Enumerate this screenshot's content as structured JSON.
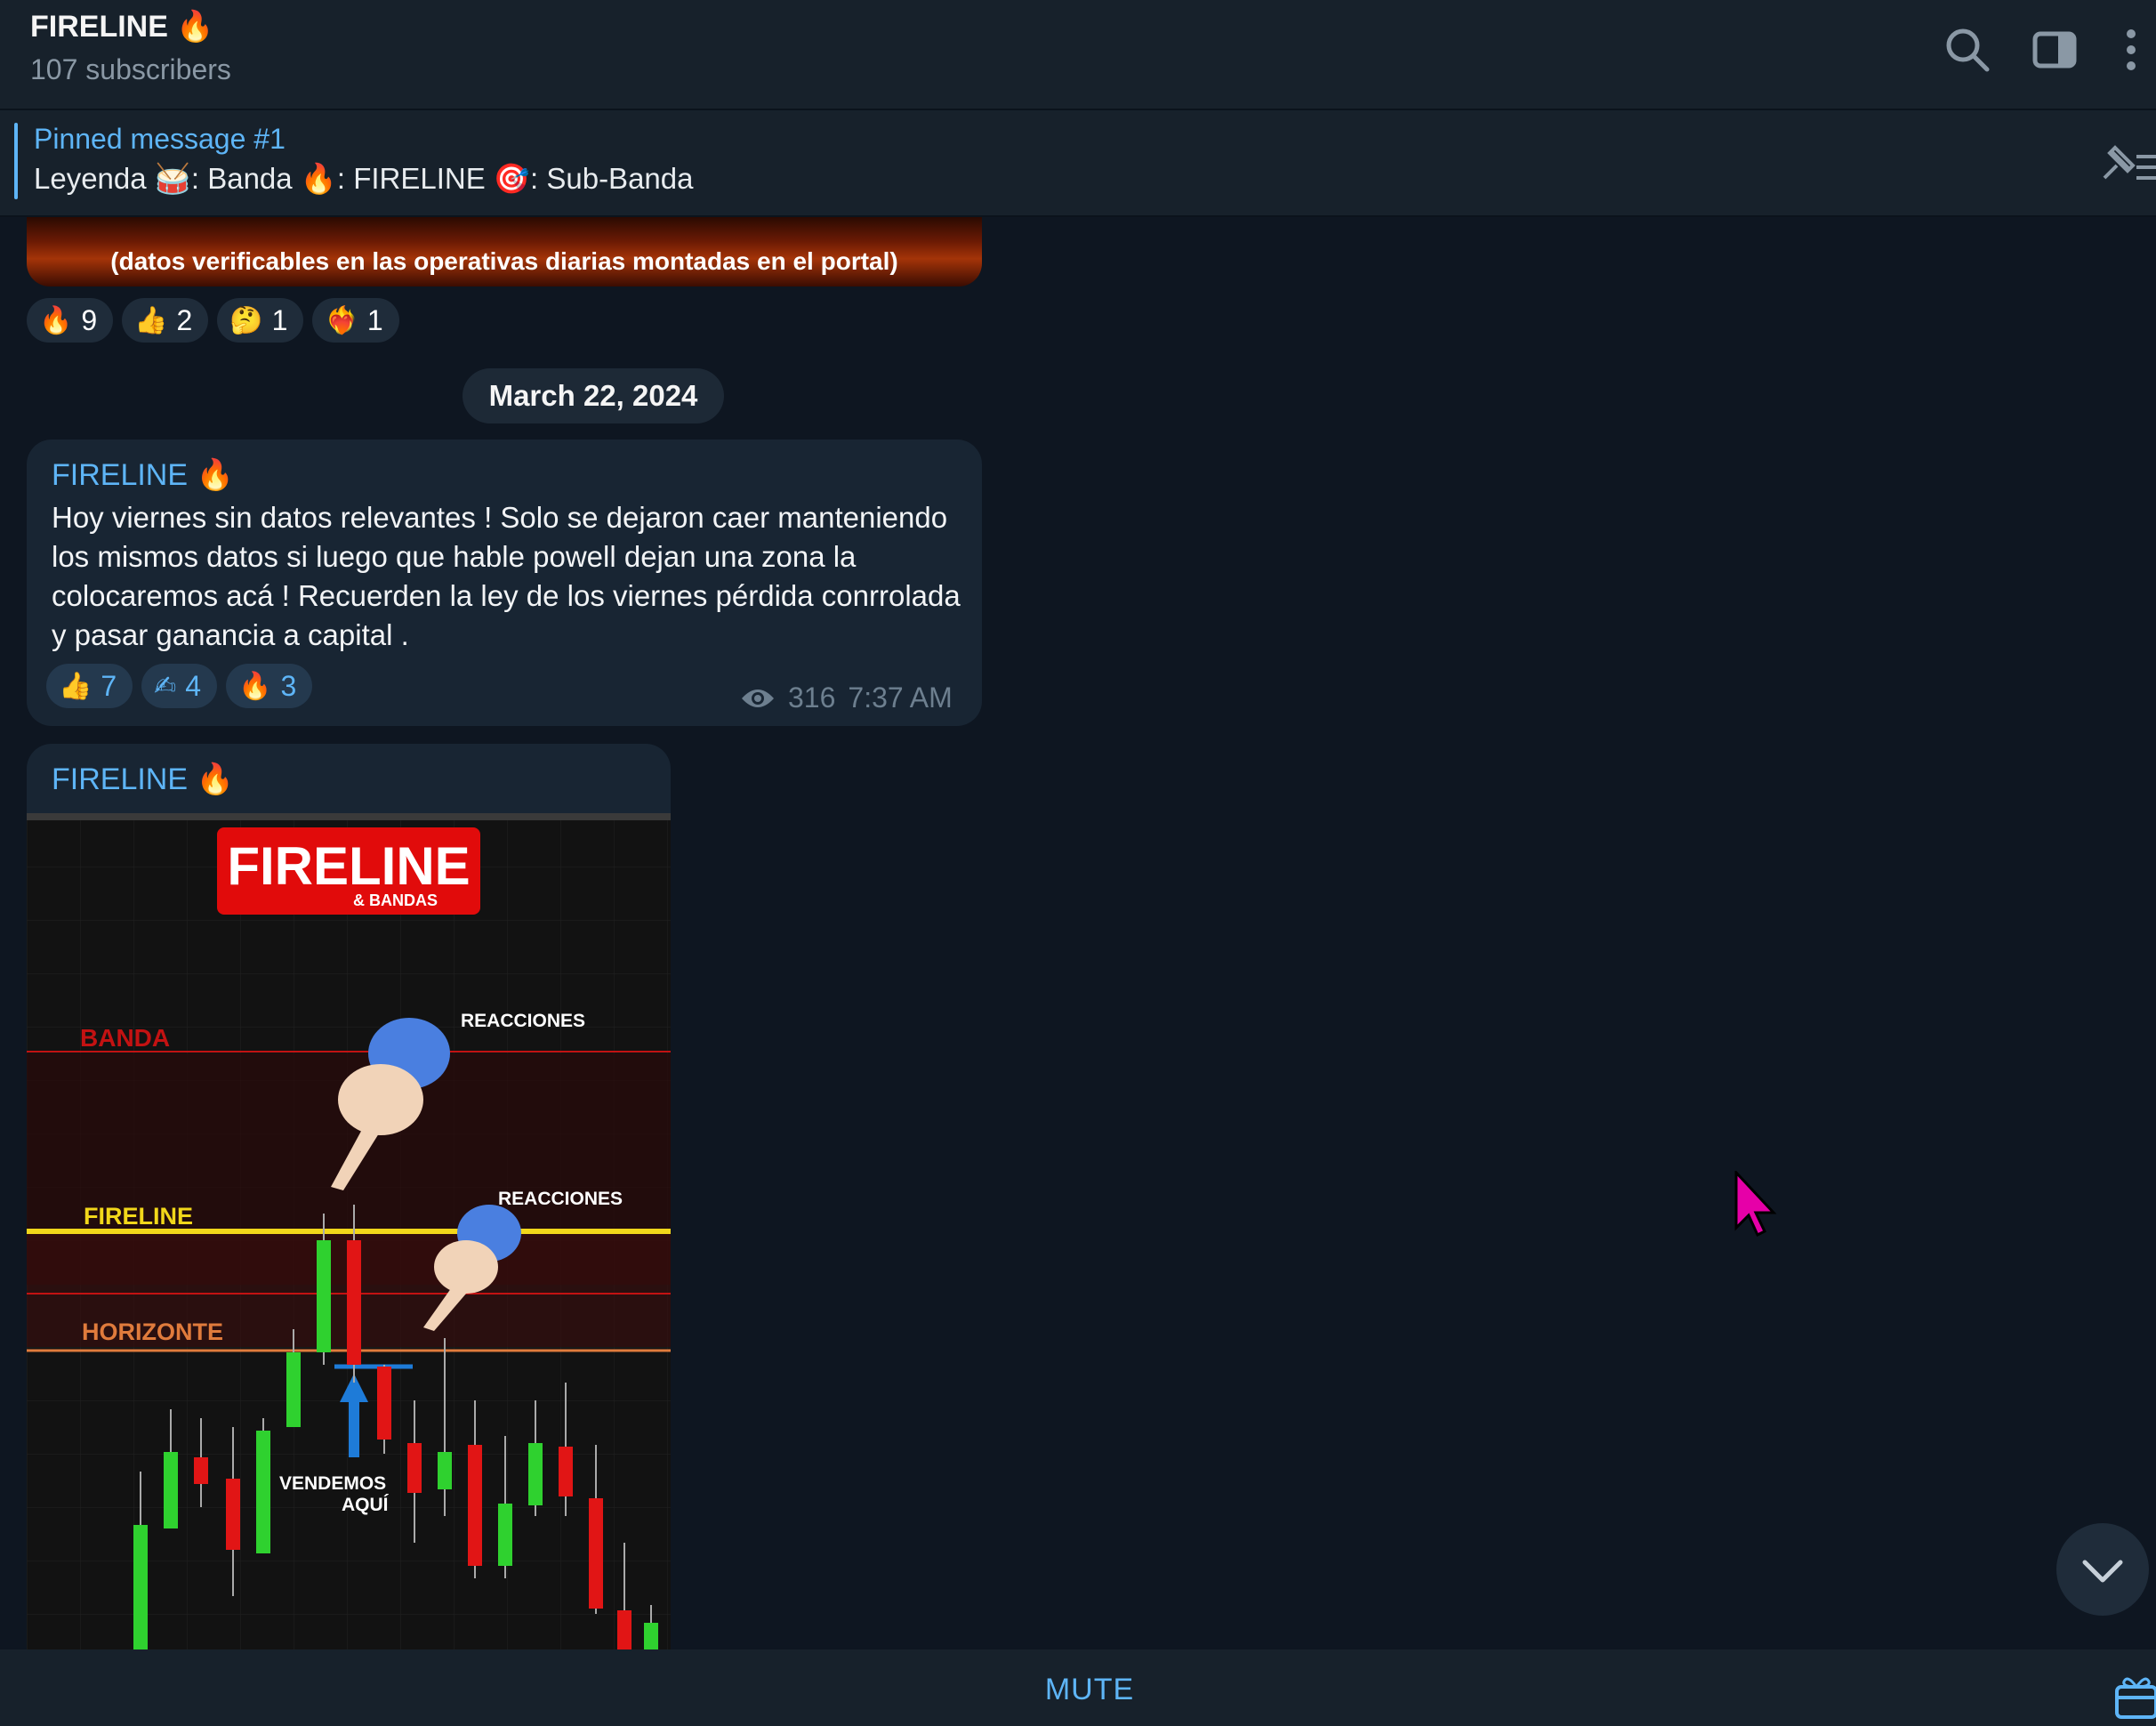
{
  "header": {
    "title": "FIRELINE",
    "title_emoji": "🔥",
    "subscribers": "107 subscribers",
    "icons": [
      "search-icon",
      "sidebar-toggle-icon",
      "more-vertical-icon"
    ]
  },
  "pinned": {
    "title": "Pinned message #1",
    "text": "Leyenda 🥁: Banda  🔥: FIRELINE  🎯: Sub-Banda"
  },
  "previous_post": {
    "image_caption": "(datos verificables en las operativas diarias montadas en el portal)",
    "reactions": [
      {
        "emoji": "🔥",
        "count": "9"
      },
      {
        "emoji": "👍",
        "count": "2"
      },
      {
        "emoji": "🤔",
        "count": "1"
      },
      {
        "emoji": "❤‍🔥",
        "count": "1"
      }
    ]
  },
  "date_separator": "March 22, 2024",
  "message1": {
    "author": "FIRELINE",
    "author_emoji": "🔥",
    "text": "Hoy viernes sin datos relevantes ! Solo se dejaron caer manteniendo los mismos datos si luego que hable powell dejan una zona la colocaremos acá ! Recuerden la ley de los viernes pérdida conrrolada y pasar ganancia a capital .",
    "reactions": [
      {
        "emoji": "👍",
        "count": "7"
      },
      {
        "emoji": "✍",
        "count": "4"
      },
      {
        "emoji": "🔥",
        "count": "3"
      }
    ],
    "views": "316",
    "time": "7:37 AM"
  },
  "message2": {
    "author": "FIRELINE",
    "author_emoji": "🔥",
    "image": {
      "logo": "FIRELINE",
      "logo_sub": "& BANDAS",
      "levels": [
        "BANDA",
        "FIRELINE",
        "HORIZONTE"
      ],
      "reaction_label_1": "REACCIONES",
      "reaction_label_2": "REACCIONES",
      "sell_label_1": "VENDEMOS",
      "sell_label_2": "AQUÍ"
    }
  },
  "bottom": {
    "mute_label": "MUTE"
  },
  "colors": {
    "background": "#0e1621",
    "panel": "#17212b",
    "bubble": "#182533",
    "accent": "#5eb5f7",
    "cursor": "#e600a8"
  }
}
